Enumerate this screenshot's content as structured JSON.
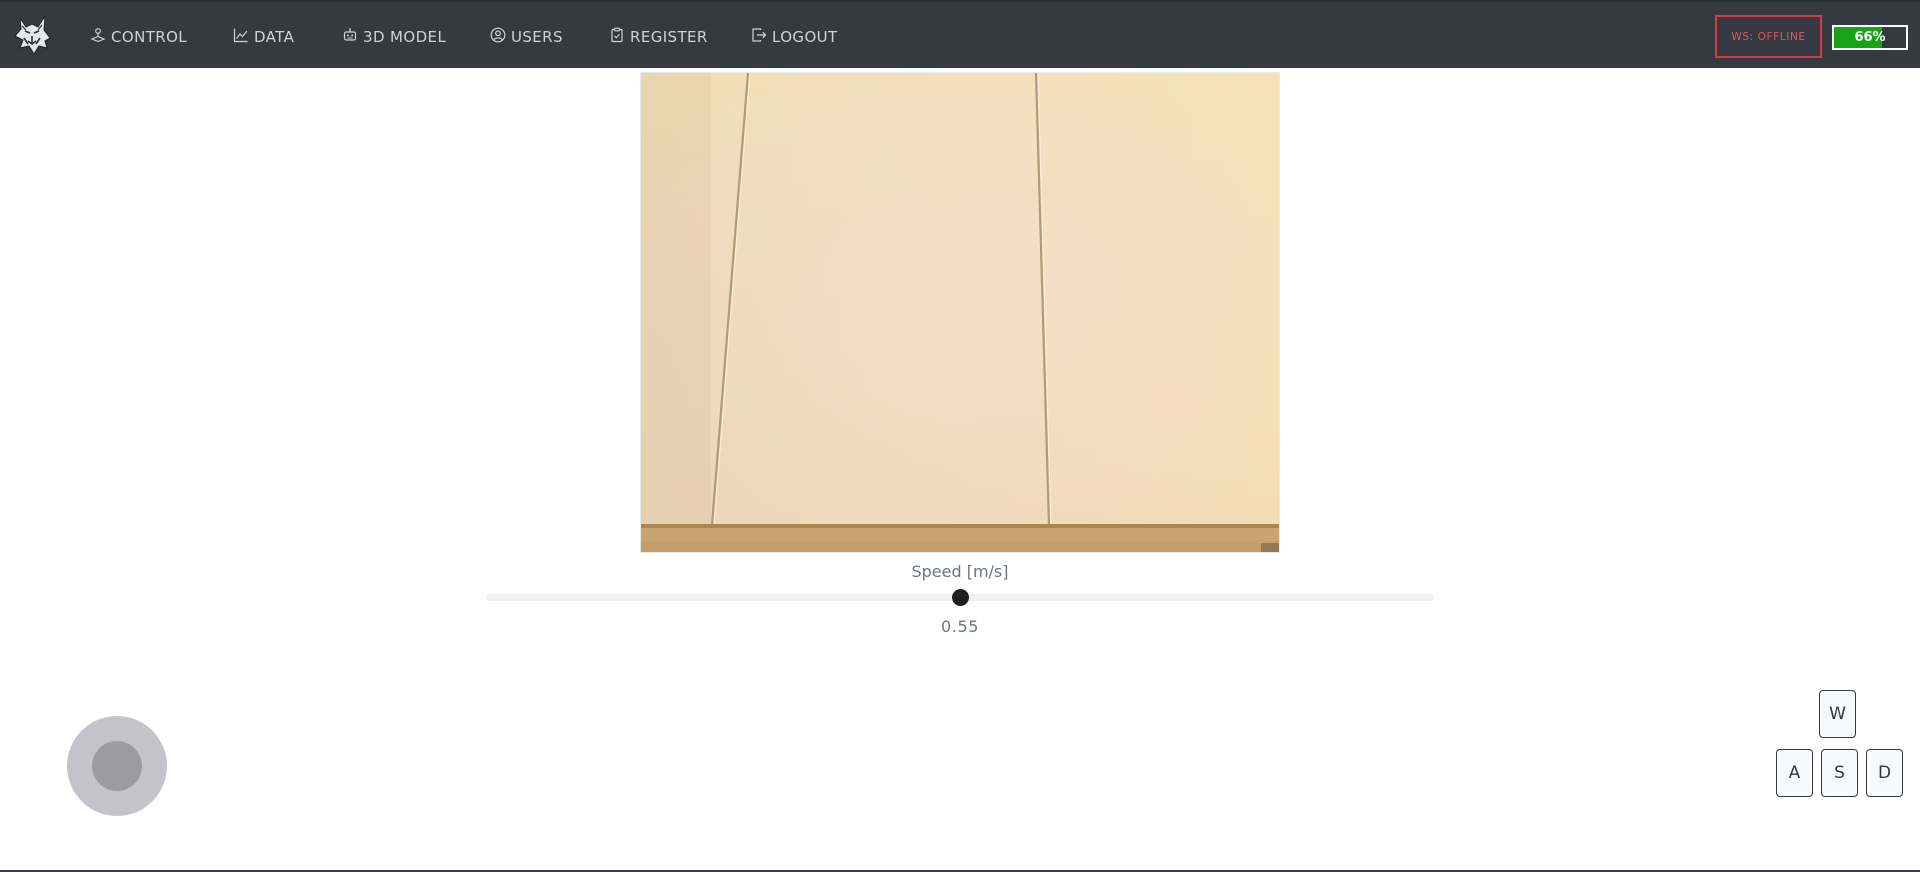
{
  "nav": {
    "items": [
      {
        "label": "CONTROL",
        "icon": "joystick-icon"
      },
      {
        "label": "DATA",
        "icon": "line-chart-icon"
      },
      {
        "label": "3D MODEL",
        "icon": "robot-icon"
      },
      {
        "label": "USERS",
        "icon": "user-circle-icon"
      },
      {
        "label": "REGISTER",
        "icon": "clipboard-icon"
      },
      {
        "label": "LOGOUT",
        "icon": "logout-icon"
      }
    ],
    "ws_status": "WS: OFFLINE",
    "battery": {
      "label": "66%",
      "level": 0.66
    }
  },
  "speed": {
    "label": "Speed [m/s]",
    "value_label": "0.55",
    "fraction": 0.5
  },
  "keys": {
    "w": "W",
    "a": "A",
    "s": "S",
    "d": "D"
  },
  "colors": {
    "navbar": "#343a40",
    "offline": "#dc3545",
    "battery_fill": "#17a21a"
  }
}
